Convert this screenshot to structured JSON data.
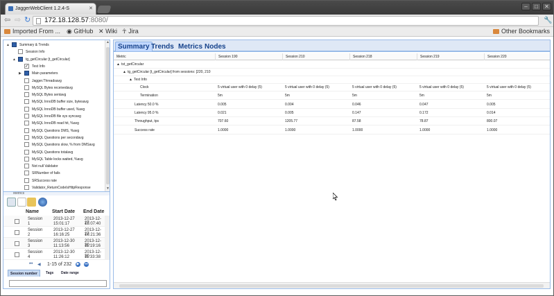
{
  "browser": {
    "tab_title": "JaggerWebClient 1.2.4-S",
    "url_host": "172.18.128.57",
    "url_rest": ":8080/",
    "bookmarks": [
      {
        "label": "Imported From ..."
      },
      {
        "label": "GitHub"
      },
      {
        "label": "Wiki"
      },
      {
        "label": "Jira"
      }
    ],
    "other_bookmarks": "Other Bookmarks"
  },
  "tree": [
    {
      "label": "Summary & Trends",
      "level": 0,
      "arrow": "▲",
      "checked": "blue"
    },
    {
      "label": "Session Info",
      "level": 1,
      "arrow": "",
      "checked": "none"
    },
    {
      "label": "tg_getCircular [t_getCircular]",
      "level": 1,
      "arrow": "▲",
      "checked": "blue"
    },
    {
      "label": "Test Info",
      "level": 2,
      "arrow": "",
      "checked": "check"
    },
    {
      "label": "Main parameters",
      "level": 2,
      "arrow": "▶",
      "checked": "blue"
    },
    {
      "label": "Jagger.Threadsavg",
      "level": 2,
      "arrow": "",
      "checked": "none"
    },
    {
      "label": "MySQL Bytes receivedavg",
      "level": 2,
      "arrow": "",
      "checked": "none"
    },
    {
      "label": "MySQL Bytes sentavg",
      "level": 2,
      "arrow": "",
      "checked": "none"
    },
    {
      "label": "MySQL InnoDB buffer size, bytesavg",
      "level": 2,
      "arrow": "",
      "checked": "none"
    },
    {
      "label": "MySQL InnoDB buffer used, %avg",
      "level": 2,
      "arrow": "",
      "checked": "none"
    },
    {
      "label": "MySQL InnoDB file sys syncavg",
      "level": 2,
      "arrow": "",
      "checked": "none"
    },
    {
      "label": "MySQL InnoDB read hit, %avg",
      "level": 2,
      "arrow": "",
      "checked": "none"
    },
    {
      "label": "MySQL Questions DMS, %avg",
      "level": 2,
      "arrow": "",
      "checked": "none"
    },
    {
      "label": "MySQL Questions per secondavg",
      "level": 2,
      "arrow": "",
      "checked": "none"
    },
    {
      "label": "MySQL Questions slow, % from DMSavg",
      "level": 2,
      "arrow": "",
      "checked": "none"
    },
    {
      "label": "MySQL Questions totalavg",
      "level": 2,
      "arrow": "",
      "checked": "none"
    },
    {
      "label": "MySQL Table locks waited, %avg",
      "level": 2,
      "arrow": "",
      "checked": "none"
    },
    {
      "label": "Not null Validator",
      "level": 2,
      "arrow": "",
      "checked": "none"
    },
    {
      "label": "SRNumber of fails",
      "level": 2,
      "arrow": "",
      "checked": "none"
    },
    {
      "label": "SRSuccess rate",
      "level": 2,
      "arrow": "",
      "checked": "none"
    },
    {
      "label": "Validator_ReturnCodeIsHttpResponse",
      "level": 2,
      "arrow": "",
      "checked": "none"
    }
  ],
  "split_label": "Metrics",
  "sessions": {
    "headers": {
      "name": "Name",
      "start": "Start Date",
      "end": "End Date"
    },
    "rows": [
      {
        "name": [
          "Session",
          "1"
        ],
        "start": [
          "2013-12-27",
          "15:01:17"
        ],
        "end": [
          "2013-12-27",
          "15:07:40"
        ]
      },
      {
        "name": [
          "Session",
          "2"
        ],
        "start": [
          "2013-12-27",
          "16:16:25"
        ],
        "end": [
          "2013-12-27",
          "16:21:36"
        ]
      },
      {
        "name": [
          "Session",
          "3"
        ],
        "start": [
          "2013-12-30",
          "11:13:56"
        ],
        "end": [
          "2013-12-30",
          "11:19:16"
        ]
      },
      {
        "name": [
          "Session",
          "4"
        ],
        "start": [
          "2013-12-30",
          "11:26:12"
        ],
        "end": [
          "2013-12-30",
          "11:33:38"
        ]
      }
    ],
    "pager_text": "1-15 of 232",
    "tabs": [
      "Session number",
      "Tags",
      "Date range"
    ]
  },
  "right": {
    "tabs": [
      "Summary",
      "Trends",
      "Metrics",
      "Nodes"
    ],
    "columns": [
      "Metric",
      "Session 190",
      "Session 210",
      "Session 218",
      "Session 219",
      "Session 220"
    ],
    "group1": "tst_getCircular",
    "group2": "tg_getCircular [t_getCircular] from sessions: [220, 210",
    "group3": "Test Info",
    "rows": [
      {
        "metric": "Clock",
        "values": [
          "5 virtual user with 0 delay (5)",
          "5 virtual user with 0 delay (5)",
          "5 virtual user with 0 delay (5)",
          "5 virtual user with 0 delay (5)",
          "5 virtual user with 0 delay (5)"
        ]
      },
      {
        "metric": "Termination",
        "values": [
          "5m",
          "5m",
          "5m",
          "5m",
          "5m"
        ]
      },
      {
        "metric": "Latency 50.0 %",
        "values": [
          "0.005",
          "0.004",
          "0.046",
          "0.047",
          "0.005"
        ]
      },
      {
        "metric": "Latency 95.0 %",
        "values": [
          "0.021",
          "0.005",
          "0.147",
          "0.172",
          "0.014"
        ]
      },
      {
        "metric": "Throughput, tps",
        "values": [
          "707.60",
          "1205.77",
          "87.58",
          "78.87",
          "800.07"
        ]
      },
      {
        "metric": "Success rate",
        "values": [
          "1.0000",
          "1.0000",
          "1.0000",
          "1.0000",
          "1.0000"
        ]
      }
    ]
  },
  "colors": {
    "accent": "#15428b",
    "panel_border": "#99bbe8",
    "tab_bg": "#dfe8f6"
  }
}
